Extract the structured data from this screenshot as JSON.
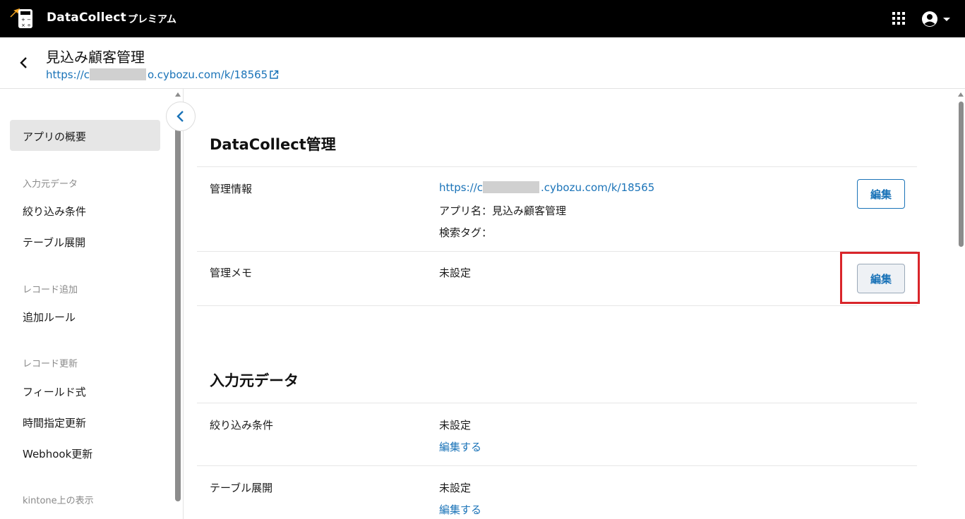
{
  "topbar": {
    "brand": "DataCollect",
    "plan": "プレミアム"
  },
  "header": {
    "title": "見込み顧客管理",
    "url_prefix": "https://c",
    "url_suffix": "o.cybozu.com/k/18565"
  },
  "sidebar": {
    "active_item": "アプリの概要",
    "groups": [
      {
        "heading": "入力元データ",
        "items": [
          "絞り込み条件",
          "テーブル展開"
        ]
      },
      {
        "heading": "レコード追加",
        "items": [
          "追加ルール"
        ]
      },
      {
        "heading": "レコード更新",
        "items": [
          "フィールド式",
          "時間指定更新",
          "Webhook更新"
        ]
      },
      {
        "heading": "kintone上の表示",
        "items": []
      }
    ]
  },
  "main": {
    "section1": {
      "title": "DataCollect管理",
      "rows": [
        {
          "label": "管理情報",
          "url_prefix": "https://c",
          "url_suffix": ".cybozu.com/k/18565",
          "app_name": "アプリ名：見込み顧客管理",
          "tags": "検索タグ：",
          "button": "編集"
        },
        {
          "label": "管理メモ",
          "value": "未設定",
          "button": "編集"
        }
      ]
    },
    "section2": {
      "title": "入力元データ",
      "rows": [
        {
          "label": "絞り込み条件",
          "value": "未設定",
          "link": "編集する"
        },
        {
          "label": "テーブル展開",
          "value": "未設定",
          "link": "編集する"
        }
      ]
    }
  },
  "colors": {
    "topbar": "#000000",
    "link": "#1a73b8",
    "highlight": "#d9252a",
    "active_bg": "#e6e6e6"
  }
}
